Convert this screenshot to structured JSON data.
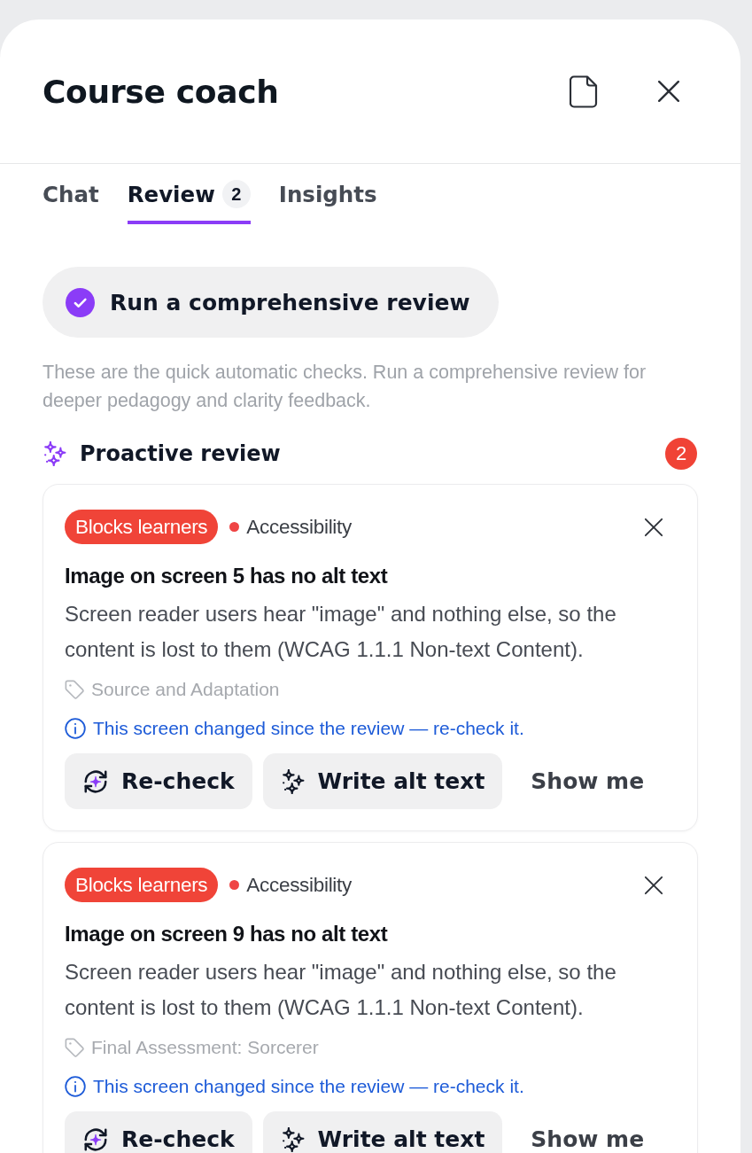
{
  "header": {
    "title": "Course coach"
  },
  "tabs": [
    {
      "label": "Chat",
      "selected": false
    },
    {
      "label": "Review",
      "selected": true,
      "count": "2"
    },
    {
      "label": "Insights",
      "selected": false
    }
  ],
  "review_button": {
    "label": "Run a comprehensive review"
  },
  "intro": "These are the quick automatic checks. Run a comprehensive review for deeper pedagogy and clarity feedback.",
  "section": {
    "title": "Proactive review",
    "count": "2"
  },
  "issues": [
    {
      "severity": "Blocks learners",
      "category": "Accessibility",
      "title": "Image on screen 5 has no alt text",
      "description": "Screen reader users hear \"image\" and nothing else, so the content is lost to them (WCAG 1.1.1 Non-text Content).",
      "location": "Source and Adaptation",
      "notice": "This screen changed since the review — re-check it.",
      "actions": [
        {
          "kind": "recheck",
          "label": "Re-check"
        },
        {
          "kind": "generate",
          "label": "Write alt text"
        },
        {
          "kind": "link",
          "label": "Show me"
        }
      ]
    },
    {
      "severity": "Blocks learners",
      "category": "Accessibility",
      "title": "Image on screen 9 has no alt text",
      "description": "Screen reader users hear \"image\" and nothing else, so the content is lost to them (WCAG 1.1.1 Non-text Content).",
      "location": "Final Assessment: Sorcerer",
      "notice": "This screen changed since the review — re-check it.",
      "actions": [
        {
          "kind": "recheck",
          "label": "Re-check"
        },
        {
          "kind": "generate",
          "label": "Write alt text"
        },
        {
          "kind": "link",
          "label": "Show me"
        }
      ]
    }
  ]
}
